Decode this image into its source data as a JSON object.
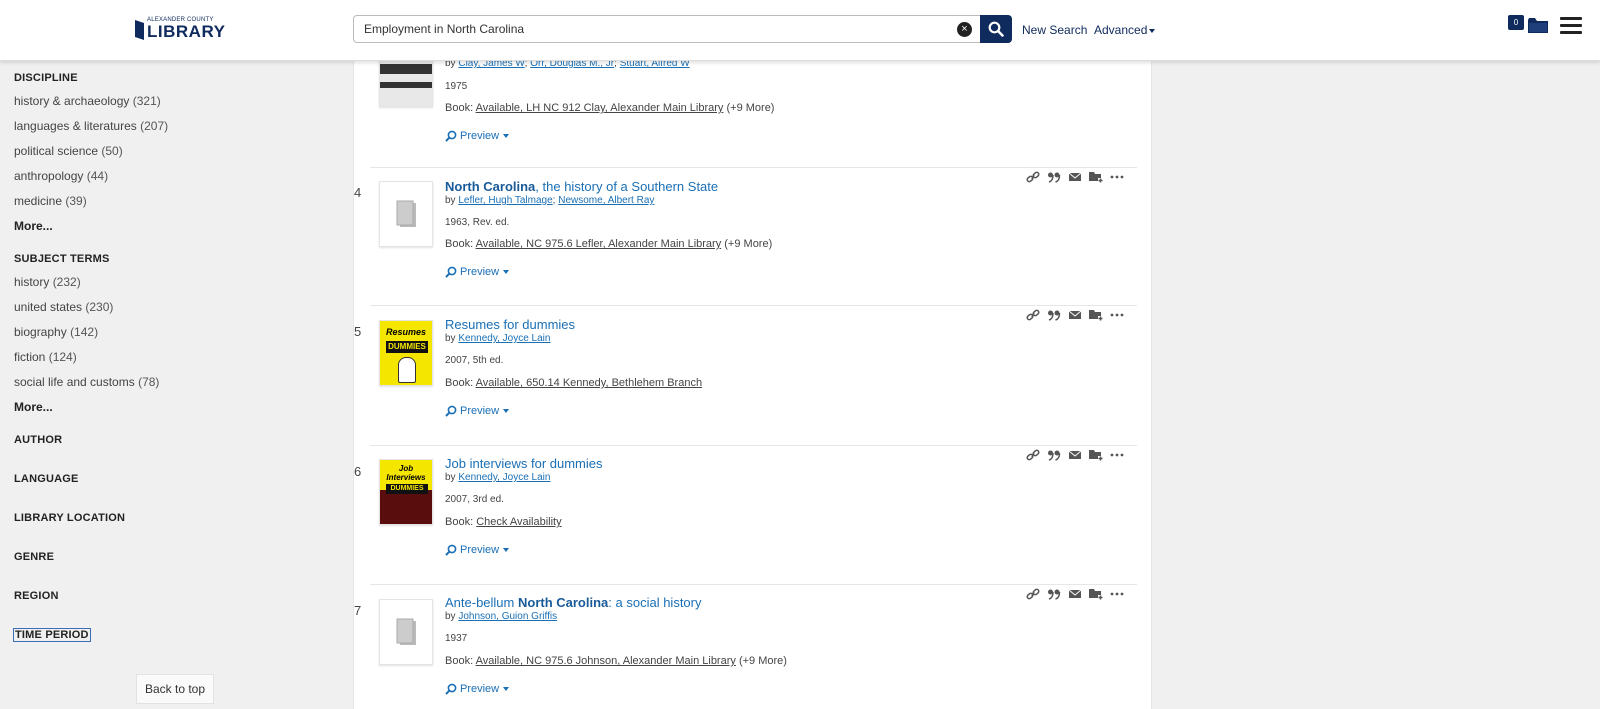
{
  "header": {
    "logo_small": "ALEXANDER COUNTY",
    "logo_big": "LIBRARY",
    "search_value": "Employment in North Carolina",
    "new_search": "New Search",
    "advanced": "Advanced",
    "cart_count": "0"
  },
  "sidebar": {
    "discipline": {
      "heading": "DISCIPLINE",
      "items": [
        {
          "label": "history & archaeology",
          "count": "(321)"
        },
        {
          "label": "languages & literatures",
          "count": "(207)"
        },
        {
          "label": "political science",
          "count": "(50)"
        },
        {
          "label": "anthropology",
          "count": "(44)"
        },
        {
          "label": "medicine",
          "count": "(39)"
        }
      ],
      "more": "More..."
    },
    "subject_terms": {
      "heading": "SUBJECT TERMS",
      "items": [
        {
          "label": "history",
          "count": "(232)"
        },
        {
          "label": "united states",
          "count": "(230)"
        },
        {
          "label": "biography",
          "count": "(142)"
        },
        {
          "label": "fiction",
          "count": "(124)"
        },
        {
          "label": "social life and customs",
          "count": "(78)"
        }
      ],
      "more": "More..."
    },
    "facets": [
      "AUTHOR",
      "LANGUAGE",
      "LIBRARY LOCATION",
      "GENRE",
      "REGION",
      "TIME PERIOD"
    ],
    "back_to_top": "Back to top"
  },
  "results": [
    {
      "num": "",
      "title_bold": "",
      "title_rest": "",
      "authors": [
        "Clay, James W",
        "Orr, Douglas M., Jr",
        "Stuart, Alfred W"
      ],
      "pubinfo": "1975",
      "avail_prefix": "Book:",
      "avail_link": "Available, LH NC 912 Clay, Alexander Main Library",
      "avail_more": "(+9 More)",
      "preview": "Preview"
    },
    {
      "num": "4",
      "title_bold": "North Carolina",
      "title_rest": ", the history of a Southern State",
      "authors": [
        "Lefler, Hugh Talmage",
        "Newsome, Albert Ray"
      ],
      "pubinfo": "1963, Rev. ed.",
      "avail_prefix": "Book:",
      "avail_link": "Available, NC 975.6 Lefler, Alexander Main Library",
      "avail_more": "(+9 More)",
      "preview": "Preview"
    },
    {
      "num": "5",
      "title_bold": "",
      "title_rest": "Resumes for dummies",
      "authors": [
        "Kennedy, Joyce Lain"
      ],
      "pubinfo": "2007, 5th ed.",
      "avail_prefix": "Book:",
      "avail_link": "Available, 650.14 Kennedy, Bethlehem Branch",
      "avail_more": "",
      "preview": "Preview",
      "cover": {
        "line1": "Resumes",
        "line2": "DUMMIES"
      }
    },
    {
      "num": "6",
      "title_bold": "",
      "title_rest": "Job interviews for dummies",
      "authors": [
        "Kennedy, Joyce Lain"
      ],
      "pubinfo": "2007, 3rd ed.",
      "avail_prefix": "Book:",
      "avail_link": "Check Availability",
      "avail_more": "",
      "preview": "Preview",
      "cover": {
        "line1": "Job Interviews",
        "line2": "DUMMIES"
      }
    },
    {
      "num": "7",
      "title_pre": "Ante-bellum ",
      "title_bold": "North Carolina",
      "title_rest": ": a social history",
      "authors": [
        "Johnson, Guion Griffis"
      ],
      "pubinfo": "1937",
      "avail_prefix": "Book:",
      "avail_link": "Available, NC 975.6 Johnson, Alexander Main Library",
      "avail_more": "(+9 More)",
      "preview": "Preview"
    }
  ],
  "colors": {
    "brand": "#0f2a5c",
    "link": "#1a6fb5"
  },
  "icons": [
    "link-icon",
    "quote-icon",
    "email-icon",
    "add-folder-icon",
    "more-icon"
  ]
}
